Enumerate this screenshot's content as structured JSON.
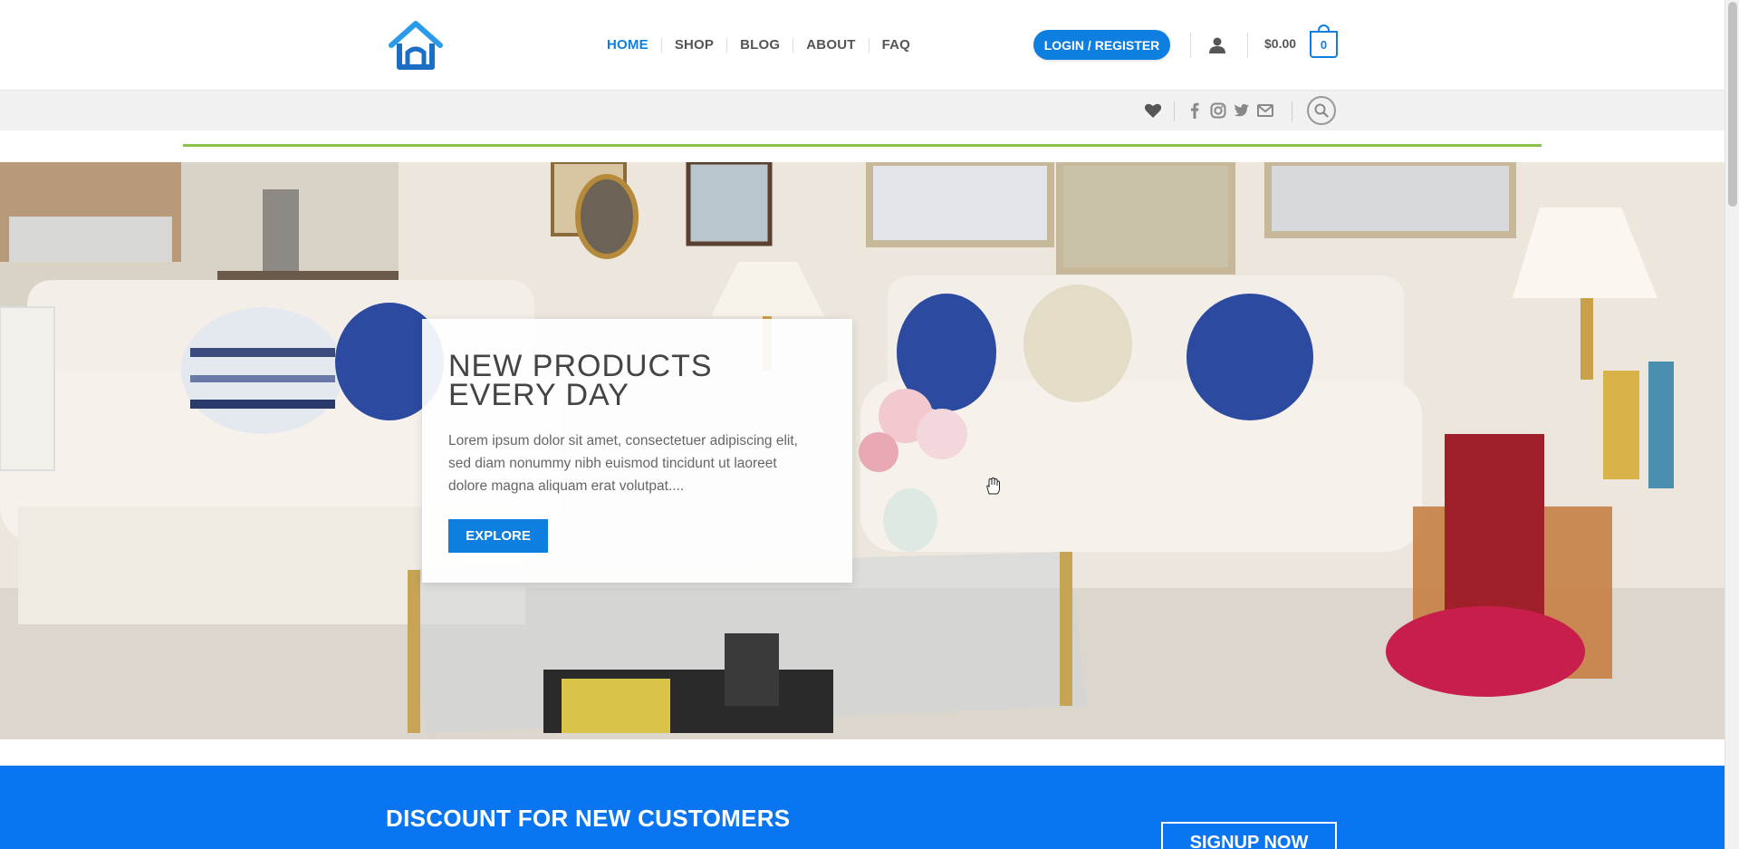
{
  "header": {
    "logo_icon": "house-outline-icon",
    "nav": [
      {
        "label": "HOME",
        "active": true
      },
      {
        "label": "SHOP",
        "active": false
      },
      {
        "label": "BLOG",
        "active": false
      },
      {
        "label": "ABOUT",
        "active": false
      },
      {
        "label": "FAQ",
        "active": false
      }
    ],
    "login_label": "LOGIN / REGISTER",
    "user_icon": "user-icon",
    "cart_total": "$0.00",
    "cart_count": "0"
  },
  "topbar": {
    "icons": [
      "heart-icon",
      "facebook-icon",
      "instagram-icon",
      "twitter-icon",
      "email-icon",
      "search-icon"
    ]
  },
  "hero": {
    "title": "NEW PRODUCTS EVERY DAY",
    "text": "Lorem ipsum dolor sit amet, consectetuer adipiscing elit, sed diam nonummy nibh euismod tincidunt ut laoreet dolore magna aliquam erat volutpat....",
    "button_label": "EXPLORE"
  },
  "discount": {
    "title": "DISCOUNT FOR NEW CUSTOMERS",
    "button_label": "SIGNUP NOW"
  },
  "colors": {
    "primary": "#0e7fe0",
    "discount_bg": "#0a75f0",
    "accent_line": "#8bc34a"
  }
}
